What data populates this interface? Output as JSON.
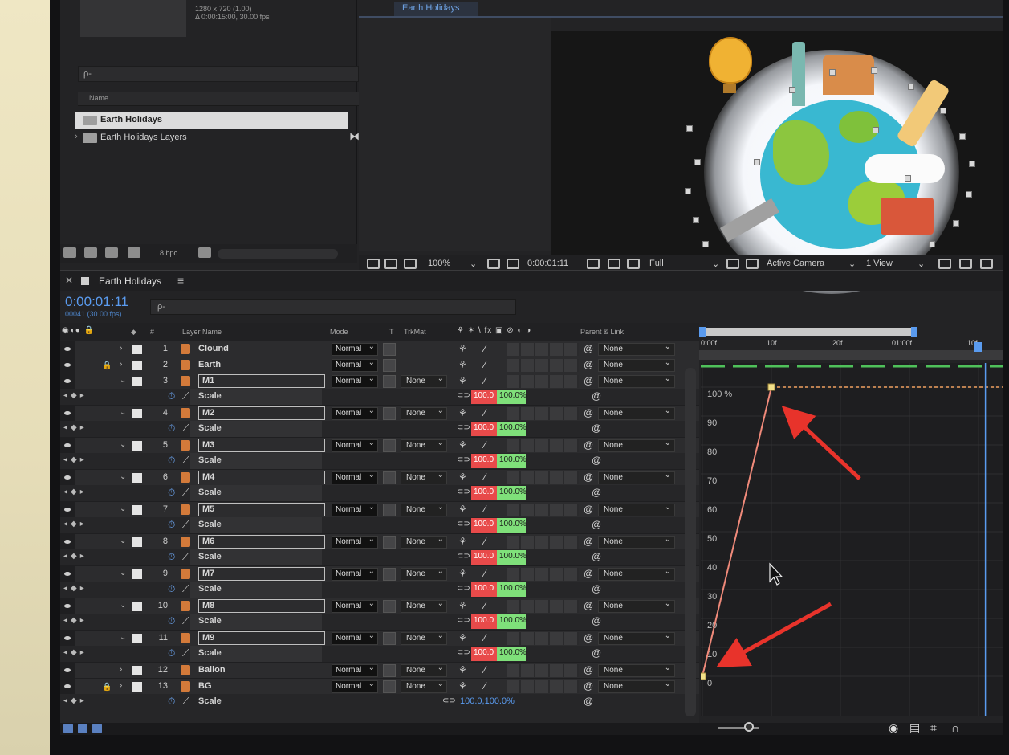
{
  "project": {
    "comp_info": "1280 x 720 (1.00)",
    "comp_duration": "Δ 0:00:15:00, 30.00 fps",
    "search_placeholder": "ρ-",
    "name_header": "Name",
    "items": [
      {
        "label": "Earth Holidays",
        "selected": true
      },
      {
        "label": "Earth Holidays Layers",
        "selected": false
      }
    ],
    "bpc": "8 bpc"
  },
  "viewer": {
    "tab": "Earth Holidays",
    "zoom": "100%",
    "timecode": "0:00:01:11",
    "resolution": "Full",
    "camera": "Active Camera",
    "view": "1 View"
  },
  "timeline": {
    "comp_name": "Earth Holidays",
    "menu_icon": "≡",
    "timecode": "0:00:01:11",
    "frame_sub": "00041 (30.00 fps)",
    "search_placeholder": "ρ-",
    "headers": {
      "num": "#",
      "layer_name": "Layer Name",
      "mode": "Mode",
      "t": "T",
      "trkmat": "TrkMat",
      "switches": "⚘ ✶ \\ fx ▣ ⊘ ◐ ◑",
      "parent": "Parent & Link"
    },
    "rows": [
      {
        "kind": "layer",
        "num": "1",
        "name": "Clound",
        "mode": "Normal",
        "trkmat": "",
        "parent": "None",
        "locked": false,
        "boxed": false
      },
      {
        "kind": "layer",
        "num": "2",
        "name": "Earth",
        "mode": "Normal",
        "trkmat": "",
        "parent": "None",
        "locked": true,
        "boxed": false
      },
      {
        "kind": "layer",
        "num": "3",
        "name": "M1",
        "mode": "Normal",
        "trkmat": "None",
        "parent": "None",
        "locked": false,
        "boxed": true
      },
      {
        "kind": "prop",
        "name": "Scale",
        "value_a": "100.0",
        "value_b": "100.0%"
      },
      {
        "kind": "layer",
        "num": "4",
        "name": "M2",
        "mode": "Normal",
        "trkmat": "None",
        "parent": "None",
        "locked": false,
        "boxed": true
      },
      {
        "kind": "prop",
        "name": "Scale",
        "value_a": "100.0",
        "value_b": "100.0%"
      },
      {
        "kind": "layer",
        "num": "5",
        "name": "M3",
        "mode": "Normal",
        "trkmat": "None",
        "parent": "None",
        "locked": false,
        "boxed": true
      },
      {
        "kind": "prop",
        "name": "Scale",
        "value_a": "100.0",
        "value_b": "100.0%"
      },
      {
        "kind": "layer",
        "num": "6",
        "name": "M4",
        "mode": "Normal",
        "trkmat": "None",
        "parent": "None",
        "locked": false,
        "boxed": true
      },
      {
        "kind": "prop",
        "name": "Scale",
        "value_a": "100.0",
        "value_b": "100.0%"
      },
      {
        "kind": "layer",
        "num": "7",
        "name": "M5",
        "mode": "Normal",
        "trkmat": "None",
        "parent": "None",
        "locked": false,
        "boxed": true
      },
      {
        "kind": "prop",
        "name": "Scale",
        "value_a": "100.0",
        "value_b": "100.0%"
      },
      {
        "kind": "layer",
        "num": "8",
        "name": "M6",
        "mode": "Normal",
        "trkmat": "None",
        "parent": "None",
        "locked": false,
        "boxed": true
      },
      {
        "kind": "prop",
        "name": "Scale",
        "value_a": "100.0",
        "value_b": "100.0%"
      },
      {
        "kind": "layer",
        "num": "9",
        "name": "M7",
        "mode": "Normal",
        "trkmat": "None",
        "parent": "None",
        "locked": false,
        "boxed": true
      },
      {
        "kind": "prop",
        "name": "Scale",
        "value_a": "100.0",
        "value_b": "100.0%"
      },
      {
        "kind": "layer",
        "num": "10",
        "name": "M8",
        "mode": "Normal",
        "trkmat": "None",
        "parent": "None",
        "locked": false,
        "boxed": true
      },
      {
        "kind": "prop",
        "name": "Scale",
        "value_a": "100.0",
        "value_b": "100.0%"
      },
      {
        "kind": "layer",
        "num": "11",
        "name": "M9",
        "mode": "Normal",
        "trkmat": "None",
        "parent": "None",
        "locked": false,
        "boxed": true
      },
      {
        "kind": "prop",
        "name": "Scale",
        "value_a": "100.0",
        "value_b": "100.0%"
      },
      {
        "kind": "layer",
        "num": "12",
        "name": "Ballon",
        "mode": "Normal",
        "trkmat": "None",
        "parent": "None",
        "locked": false,
        "boxed": false
      },
      {
        "kind": "layer",
        "num": "13",
        "name": "BG",
        "mode": "Normal",
        "trkmat": "None",
        "parent": "None",
        "locked": true,
        "boxed": false
      },
      {
        "kind": "prop-plain",
        "name": "Scale",
        "value": "100.0,100.0%"
      }
    ]
  },
  "graph": {
    "ruler_ticks": [
      "0:00f",
      "10f",
      "20f",
      "01:00f",
      "10f"
    ],
    "y_labels": [
      "100 %",
      "90",
      "80",
      "70",
      "60",
      "50",
      "40",
      "30",
      "20",
      "10",
      "0"
    ],
    "keyframes": [
      {
        "frame": 0,
        "value": 0
      },
      {
        "frame": 10,
        "value": 100
      }
    ],
    "current_frame": 41,
    "accent": "#5a9bef",
    "curve_color": "#f08a7a"
  }
}
